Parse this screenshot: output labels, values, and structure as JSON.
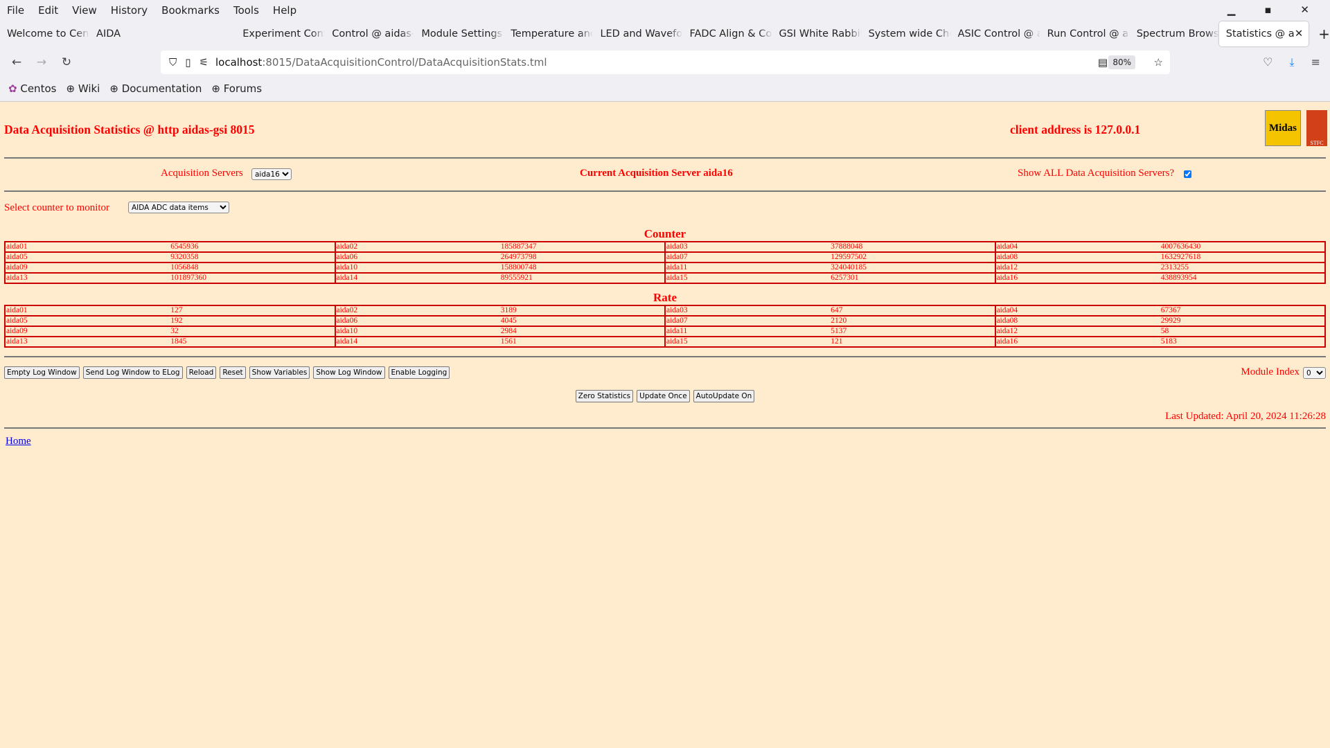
{
  "browser": {
    "menu": [
      "File",
      "Edit",
      "View",
      "History",
      "Bookmarks",
      "Tools",
      "Help"
    ],
    "tabs": [
      "Welcome to Centos",
      "AIDA",
      "Experiment Control",
      "Control @ aidas-gsi",
      "Module Settings",
      "Temperature and",
      "LED and Waveform",
      "FADC Align & Control",
      "GSI White Rabbit",
      "System wide Checks",
      "ASIC Control @ aidas",
      "Run Control @ aidas",
      "Spectrum Browser",
      "Statistics @ aidas"
    ],
    "url_host": "localhost",
    "url_path": ":8015/DataAcquisitionControl/DataAcquisitionStats.tml",
    "zoom": "80%",
    "bookmarks": [
      "Centos",
      "Wiki",
      "Documentation",
      "Forums"
    ]
  },
  "page": {
    "title": "Data Acquisition Statistics @ http aidas-gsi 8015",
    "client": "client address is 127.0.0.1",
    "logo_text": "Midas",
    "acq_label": "Acquisition Servers",
    "acq_selected": "aida16",
    "current_server": "Current Acquisition Server aida16",
    "show_all_label": "Show ALL Data Acquisition Servers?",
    "show_all_checked": true,
    "counter_label": "Select counter to monitor",
    "counter_selected": "AIDA ADC data items",
    "counter_heading": "Counter",
    "rate_heading": "Rate",
    "counter_rows": [
      [
        [
          "aida01",
          "6545936"
        ],
        [
          "aida02",
          "185887347"
        ],
        [
          "aida03",
          "37888048"
        ],
        [
          "aida04",
          "4007636430"
        ]
      ],
      [
        [
          "aida05",
          "9320358"
        ],
        [
          "aida06",
          "264973798"
        ],
        [
          "aida07",
          "129597502"
        ],
        [
          "aida08",
          "1632927618"
        ]
      ],
      [
        [
          "aida09",
          "1056848"
        ],
        [
          "aida10",
          "158800748"
        ],
        [
          "aida11",
          "324040185"
        ],
        [
          "aida12",
          "2313255"
        ]
      ],
      [
        [
          "aida13",
          "101897360"
        ],
        [
          "aida14",
          "89555921"
        ],
        [
          "aida15",
          "6257301"
        ],
        [
          "aida16",
          "438893954"
        ]
      ]
    ],
    "rate_rows": [
      [
        [
          "aida01",
          "127"
        ],
        [
          "aida02",
          "3189"
        ],
        [
          "aida03",
          "647"
        ],
        [
          "aida04",
          "67367"
        ]
      ],
      [
        [
          "aida05",
          "192"
        ],
        [
          "aida06",
          "4045"
        ],
        [
          "aida07",
          "2120"
        ],
        [
          "aida08",
          "29929"
        ]
      ],
      [
        [
          "aida09",
          "32"
        ],
        [
          "aida10",
          "2984"
        ],
        [
          "aida11",
          "5137"
        ],
        [
          "aida12",
          "58"
        ]
      ],
      [
        [
          "aida13",
          "1845"
        ],
        [
          "aida14",
          "1561"
        ],
        [
          "aida15",
          "121"
        ],
        [
          "aida16",
          "5183"
        ]
      ]
    ],
    "buttons": [
      "Empty Log Window",
      "Send Log Window to ELog",
      "Reload",
      "Reset",
      "Show Variables",
      "Show Log Window",
      "Enable Logging"
    ],
    "module_index_label": "Module Index",
    "module_index": "0",
    "buttons2": [
      "Zero Statistics",
      "Update Once",
      "AutoUpdate On"
    ],
    "last_updated": "Last Updated: April 20, 2024 11:26:28",
    "home": "Home"
  },
  "colors": {
    "accent": "#ff0000",
    "background": "#ffebcd"
  }
}
